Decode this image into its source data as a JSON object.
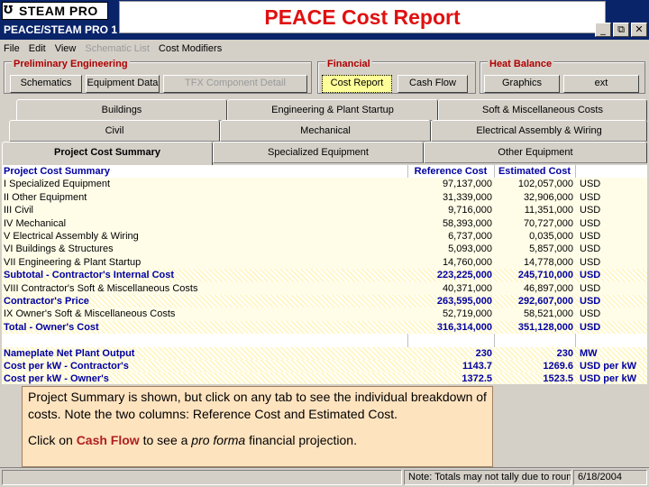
{
  "app": {
    "logo_mark": "Ʊ",
    "logo_text": "STEAM PRO",
    "window_title_left": "PEACE/STEAM PRO 1",
    "window_title_dim": "",
    "banner": "PEACE Cost Report"
  },
  "window_buttons": [
    "_",
    "⧉",
    "✕"
  ],
  "menu": [
    {
      "label": "File",
      "enabled": true
    },
    {
      "label": "Edit",
      "enabled": true
    },
    {
      "label": "View",
      "enabled": true
    },
    {
      "label": "Schematic List",
      "enabled": false
    },
    {
      "label": "Cost Modifiers",
      "enabled": true
    }
  ],
  "groups": {
    "preliminary": {
      "label": "Preliminary Engineering",
      "buttons": [
        {
          "label": "Schematics",
          "enabled": true
        },
        {
          "label": "Equipment Data",
          "enabled": true
        },
        {
          "label": "TFX Component Detail",
          "enabled": false
        }
      ]
    },
    "financial": {
      "label": "Financial",
      "buttons": [
        {
          "label": "Cost Report",
          "enabled": true,
          "selected": true
        },
        {
          "label": "Cash Flow",
          "enabled": true
        }
      ]
    },
    "heat_balance": {
      "label": "Heat Balance",
      "buttons": [
        {
          "label": "Graphics",
          "enabled": true
        },
        {
          "label": "ext",
          "enabled": true
        }
      ]
    }
  },
  "tabs": {
    "row1": [
      "Buildings",
      "Engineering & Plant Startup",
      "Soft & Miscellaneous Costs"
    ],
    "row2": [
      "Civil",
      "Mechanical",
      "Electrical Assembly & Wiring"
    ],
    "row3": [
      "Project Cost Summary",
      "Specialized Equipment",
      "Other Equipment"
    ]
  },
  "table": {
    "header": [
      "Project Cost Summary",
      "Reference Cost",
      "Estimated Cost",
      ""
    ],
    "rows": [
      {
        "kind": "item",
        "cells": [
          "I    Specialized Equipment",
          "97,137,000",
          "102,057,000",
          "USD"
        ]
      },
      {
        "kind": "item",
        "cells": [
          "II   Other Equipment",
          "31,339,000",
          "32,906,000",
          "USD"
        ]
      },
      {
        "kind": "item",
        "cells": [
          "III  Civil",
          "9,716,000",
          "11,351,000",
          "USD"
        ]
      },
      {
        "kind": "item",
        "cells": [
          "IV   Mechanical",
          "58,393,000",
          "70,727,000",
          "USD"
        ]
      },
      {
        "kind": "item",
        "cells": [
          "V    Electrical Assembly & Wiring",
          "6,737,000",
          "0,035,000",
          "USD"
        ]
      },
      {
        "kind": "item",
        "cells": [
          "VI   Buildings & Structures",
          "5,093,000",
          "5,857,000",
          "USD"
        ]
      },
      {
        "kind": "item",
        "cells": [
          "VII  Engineering & Plant Startup",
          "14,760,000",
          "14,778,000",
          "USD"
        ]
      },
      {
        "kind": "sub",
        "cells": [
          "Subtotal - Contractor's Internal Cost",
          "223,225,000",
          "245,710,000",
          "USD"
        ]
      },
      {
        "kind": "item",
        "cells": [
          "VIII Contractor's Soft & Miscellaneous Costs",
          "40,371,000",
          "46,897,000",
          "USD"
        ]
      },
      {
        "kind": "sub",
        "cells": [
          "Contractor's Price",
          "263,595,000",
          "292,607,000",
          "USD"
        ]
      },
      {
        "kind": "item",
        "cells": [
          "IX Owner's Soft & Miscellaneous Costs",
          "52,719,000",
          "58,521,000",
          "USD"
        ]
      },
      {
        "kind": "sub",
        "cells": [
          "Total - Owner's Cost",
          "316,314,000",
          "351,128,000",
          "USD"
        ]
      },
      {
        "kind": "blank",
        "cells": [
          "",
          "",
          "",
          ""
        ]
      },
      {
        "kind": "metric",
        "cells": [
          "Nameplate Net Plant Output",
          "230",
          "230",
          "MW"
        ]
      },
      {
        "kind": "metric",
        "cells": [
          "Cost per kW - Contractor's",
          "1143.7",
          "1269.6",
          "USD per kW"
        ]
      },
      {
        "kind": "metric",
        "cells": [
          "Cost per kW - Owner's",
          "1372.5",
          "1523.5",
          "USD per kW"
        ]
      }
    ]
  },
  "callout": {
    "line1": "Project Summary is shown, but click on any tab to see the individual breakdown of costs.  Note the two columns: Reference Cost and Estimated Cost.",
    "line2_pre": "Click on ",
    "line2_link": "Cash Flow",
    "line2_mid": " to see a ",
    "line2_em": "pro forma",
    "line2_post": " financial projection."
  },
  "status": {
    "note": "Note: Totals may not tally due to roundoff.",
    "date": "6/18/2004"
  }
}
